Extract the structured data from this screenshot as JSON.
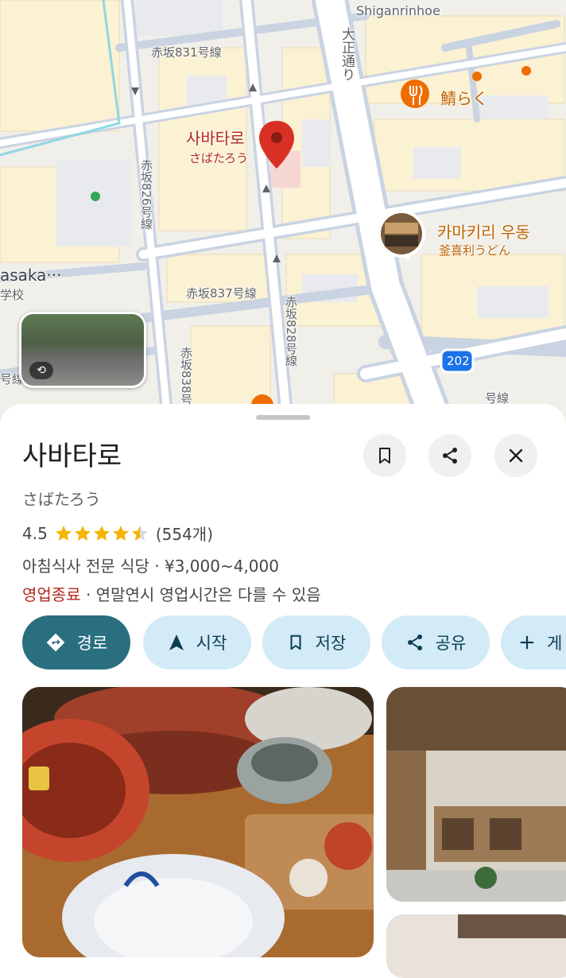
{
  "map": {
    "road_labels": {
      "shiganrin": "Shiganrinhoe",
      "akasaka831": "赤坂831号線",
      "taisho": "大正通り",
      "akasaka826": "赤坂826号線",
      "akasaka837": "赤坂837号線",
      "akasaka828": "赤坂828号線",
      "akasaka838": "赤坂838号線",
      "left_clip": "号線",
      "right_clip": "号線",
      "area": "asaka···",
      "school": "学校",
      "route_no": "202"
    },
    "selected_pin": {
      "title": "사바타로",
      "subtitle": "さばたろう",
      "color": "#d93025"
    },
    "poi_saba": {
      "title": "鯖らく",
      "color": "#ef6c00"
    },
    "poi_kamakiri": {
      "title": "카마키리 우동",
      "subtitle": "釜喜利うどん"
    },
    "streetview_icon": "street-view-360-icon"
  },
  "place": {
    "name": "사바타로",
    "name_jp": "さばたろう",
    "rating": "4.5",
    "rating_value": 4.5,
    "review_count": "(554개)",
    "category_price": "아침식사 전문 식당 · ¥3,000~4,000",
    "status": "영업종료",
    "hours_note": " · 연말연시 영업시간은 다를 수 있음"
  },
  "actions": {
    "directions": "경로",
    "start": "시작",
    "save": "저장",
    "share": "공유",
    "more": "게"
  },
  "header_icons": [
    "bookmark-icon",
    "share-icon",
    "close-icon"
  ],
  "colors": {
    "primary_chip": "#2a6f80",
    "chip_bg": "#d3ebf7",
    "star": "#f4b400",
    "closed": "#b3261e"
  }
}
